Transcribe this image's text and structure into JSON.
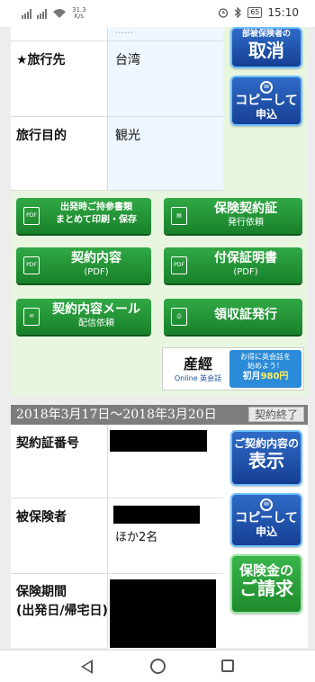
{
  "status_bar": {
    "network_speed": "31.3\nK/s",
    "battery": "65",
    "time": "15:10",
    "icons": [
      "signal-icon",
      "signal-icon",
      "wifi-icon",
      "alarm-icon",
      "bluetooth-icon",
      "battery-icon"
    ]
  },
  "trip": {
    "rows": [
      {
        "label": "",
        "value": "……"
      },
      {
        "label": "★旅行先",
        "value": "台湾"
      },
      {
        "label": "旅行目的",
        "value": "観光"
      }
    ]
  },
  "side_buttons_1": {
    "cancel_top": "部被保険者の",
    "cancel_label": "取消",
    "copy_line1": "コピーして",
    "copy_line2": "申込"
  },
  "action_buttons": [
    {
      "line1": "出発時ご持参書類",
      "line2": "まとめて印刷・保存",
      "icon": "pdf-icon"
    },
    {
      "line1": "保険契約証",
      "line2": "発行依頼",
      "icon": "document-icon"
    },
    {
      "line1": "契約内容",
      "line2": "(PDF)",
      "icon": "pdf-icon"
    },
    {
      "line1": "付保証明書",
      "line2": "(PDF)",
      "icon": "pdf-icon"
    },
    {
      "line1": "契約内容メール",
      "line2": "配信依頼",
      "icon": "mail-icon"
    },
    {
      "line1": "領収証発行",
      "line2": "",
      "icon": "printer-icon"
    }
  ],
  "ad": {
    "brand": "産經",
    "brand_sub": "Online 英会話",
    "line1": "お得に英会話を",
    "line2": "始めよう！",
    "price_prefix": "初月",
    "price": "980円"
  },
  "contract2": {
    "period_header": "2018年3月17日〜2018年3月20日",
    "status_badge": "契約終了",
    "rows": [
      {
        "label": "契約証番号",
        "value": ""
      },
      {
        "label": "被保険者",
        "value": "ほか2名"
      },
      {
        "label": "保険期間\n(出発日/帰宅日)",
        "value": ""
      }
    ]
  },
  "side_buttons_2": {
    "view_top": "ご契約内容の",
    "view_label": "表示",
    "copy_line1": "コピーして",
    "copy_line2": "申込",
    "claim_top": "保険金の",
    "claim_label": "ご請求"
  },
  "colors": {
    "panel_green": "#e8f6e0",
    "button_green": "#2fa542",
    "button_blue": "#1f56b5",
    "header_gray": "#7d7d7d"
  }
}
